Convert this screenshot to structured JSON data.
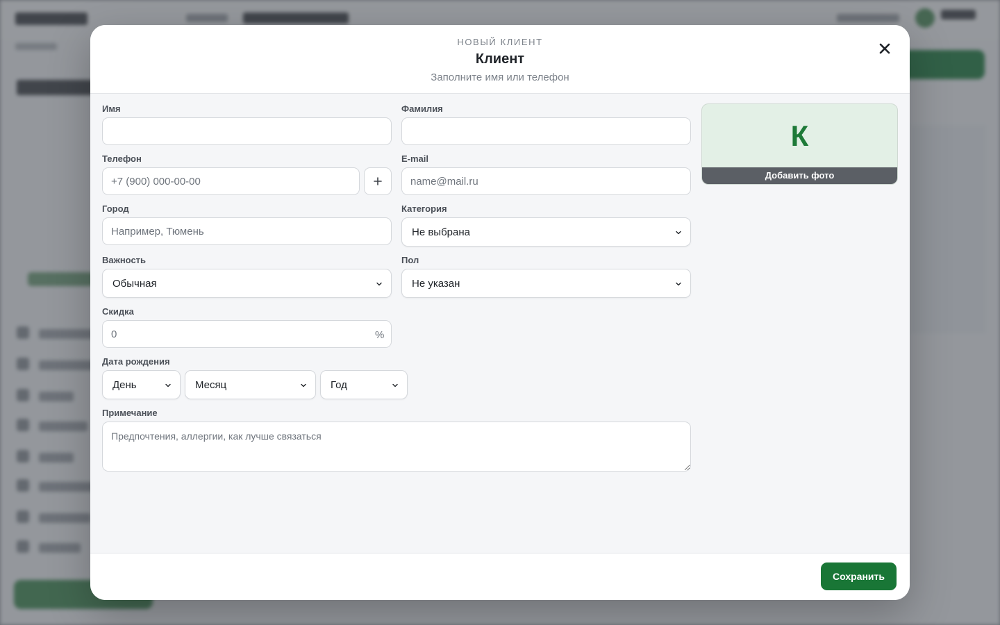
{
  "modal": {
    "eyebrow": "НОВЫЙ КЛИЕНТ",
    "title": "Клиент",
    "subtitle": "Заполните имя или телефон",
    "close_icon": "close-icon"
  },
  "form": {
    "first_name": {
      "label": "Имя",
      "value": "",
      "placeholder": ""
    },
    "last_name": {
      "label": "Фамилия",
      "value": "",
      "placeholder": ""
    },
    "phone": {
      "label": "Телефон",
      "value": "",
      "placeholder": "+7 (900) 000-00-00",
      "add_icon": "plus-icon"
    },
    "email": {
      "label": "E-mail",
      "value": "",
      "placeholder": "name@mail.ru"
    },
    "city": {
      "label": "Город",
      "value": "",
      "placeholder": "Например, Тюмень"
    },
    "category": {
      "label": "Категория",
      "selected": "Не выбрана"
    },
    "importance": {
      "label": "Важность",
      "selected": "Обычная"
    },
    "gender": {
      "label": "Пол",
      "selected": "Не указан"
    },
    "discount": {
      "label": "Скидка",
      "value": "",
      "placeholder": "0",
      "unit": "%"
    },
    "birthdate": {
      "label": "Дата рождения",
      "day": "День",
      "month": "Месяц",
      "year": "Год"
    },
    "note": {
      "label": "Примечание",
      "value": "",
      "placeholder": "Предпочтения, аллергии, как лучше связаться"
    }
  },
  "photo": {
    "initial": "К",
    "add_label": "Добавить фото"
  },
  "footer": {
    "save_label": "Сохранить"
  },
  "colors": {
    "accent": "#197636",
    "avatar_bg": "#e3f0e6",
    "avatar_letter": "#1e7a38"
  }
}
